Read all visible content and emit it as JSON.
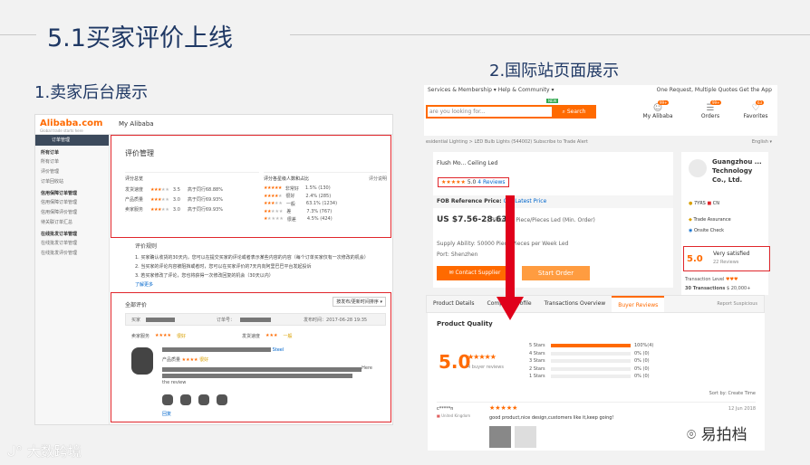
{
  "slide": {
    "title": "5.1买家评价上线",
    "sub_left": "1.卖家后台展示",
    "sub_right": "2.国际站页面展示",
    "footer_logo": "大数跨境",
    "watermark": "易拍档"
  },
  "backend": {
    "brand": "Alibaba.com",
    "brand_sub": "Global trade starts here",
    "my": "My Alibaba",
    "sidebar": {
      "header": "订单管理",
      "groups": [
        {
          "label": "所有订单",
          "items": [
            "所有订单",
            "评价管理",
            "订单回收站"
          ]
        },
        {
          "label": "信用保障订单管理",
          "items": [
            "信用保障订单管理",
            "信用保障评价管理",
            "待关联订单汇总"
          ]
        },
        {
          "label": "在线批发订单管理",
          "items": [
            "在线批发订单管理",
            "在线批发评价管理"
          ]
        }
      ]
    },
    "eval_title": "评价管理",
    "overview_title": "评分总览",
    "stats": [
      {
        "k": "发货速度",
        "v": "3.5",
        "cmp": "高于同行68.88%"
      },
      {
        "k": "产品质量",
        "v": "3.0",
        "cmp": "高于同行69.93%"
      },
      {
        "k": "卖家服务",
        "v": "3.0",
        "cmp": "高于同行69.93%"
      }
    ],
    "dist_title": "评分各星级人数和占比",
    "dist_note": "评分说明",
    "dist": [
      {
        "l": "非常好",
        "p": "1.5% (130)"
      },
      {
        "l": "很好",
        "p": "2.4% (285)"
      },
      {
        "l": "一般",
        "p": "63.1% (1234)"
      },
      {
        "l": "差",
        "p": "7.3% (767)"
      },
      {
        "l": "很差",
        "p": "4.5% (424)"
      }
    ],
    "rules_title": "评价规则",
    "rules": [
      "1. 买家确认收货的30天内，您可以在提交买家的评论或者表示某些内容的内容（每个订单买家仅有一次修改的机会）",
      "2. 当买家的评论内容被阻挡或者时，您可以在买家评价的7天内向阿里巴巴平台发起投诉",
      "3. 若买家修改了评论，您也将获得一次修改回复的机会（30天以内）"
    ],
    "rules_more": "了解更多",
    "all_reviews": "全部评价",
    "sort": "按发布/更新时间排序",
    "buyer_label": "买家",
    "order_label": "订单号：",
    "date": "发布时间：2017-06-28 19:35",
    "svc_label": "卖家服务",
    "svc_text": "很好",
    "ship_label": "发货速度",
    "ship_text": "一般",
    "prod_link_end": "Steel",
    "prod_quality": "产品质量",
    "prod_q_text": "很好",
    "rev_text_end": "Here",
    "rev_more": "the review",
    "reply": "回复"
  },
  "site": {
    "nav_left": "Services & Membership ▾    Help & Community ▾",
    "nav_right": "One Request, Multiple Quotes    Get the App",
    "search_ph": "are you looking for...",
    "search_btn": "Search",
    "new": "NEW",
    "icons": [
      {
        "n": "My Alibaba",
        "b": "99+"
      },
      {
        "n": "Orders",
        "b": "99+"
      },
      {
        "n": "Favorites",
        "b": "63"
      }
    ],
    "crumb": "esidential Lighting  >  LED Bulb Lights  (544002)     Subscribe to Trade Alert",
    "lang": "English ▾",
    "product_name": "Flush Mo... Ceiling Led",
    "rating_value": "5.0",
    "reviews": "4 Reviews",
    "fob": "FOB Reference Price:",
    "fob_link": "Get Latest Price",
    "price": "US $7.56-28.63",
    "price_unit": "/ Piece | 1 Piece/Pieces Led (Min. Order)",
    "supply_lbl": "Supply Ability:",
    "supply_val": "50000 Piece/Pieces per Week Led",
    "port_lbl": "Port:",
    "port_val": "Shenzhen",
    "contact": "Contact Supplier",
    "order": "Start Order",
    "seller_name": "Guangzhou ... Technology Co., Ltd.",
    "yrs": "7YRS",
    "cn": "CN",
    "assurance": "Trade Assurance",
    "onsite": "Onsite Check",
    "satisfaction_score": "5.0",
    "satisfaction_label": "Very satisfied",
    "satisfaction_reviews": "22 Reviews",
    "tx_level": "Transaction Level",
    "tx_count": "30 Transactions",
    "tx_amount": "20,000+",
    "tabs": [
      "Product Details",
      "Company Profile",
      "Transactions Overview",
      "Buyer Reviews",
      "Report Suspicious"
    ],
    "quality_title": "Product Quality",
    "score": "5.0",
    "buyer_reviews": "4 buyer reviews",
    "hist": [
      {
        "l": "5 Stars",
        "p": "100%(4)",
        "f": 1
      },
      {
        "l": "4 Stars",
        "p": "0%  (0)",
        "f": 0
      },
      {
        "l": "3 Stars",
        "p": "0%  (0)",
        "f": 0
      },
      {
        "l": "2 Stars",
        "p": "0%  (0)",
        "f": 0
      },
      {
        "l": "1 Stars",
        "p": "0%  (0)",
        "f": 0
      }
    ],
    "sort_by": "Sort by: Create Time",
    "reviewer": "c*****n",
    "country": "United Kingdom",
    "review_date": "12 Jun 2018",
    "review_text": "good product,nice design,customers like it,keep going!"
  }
}
